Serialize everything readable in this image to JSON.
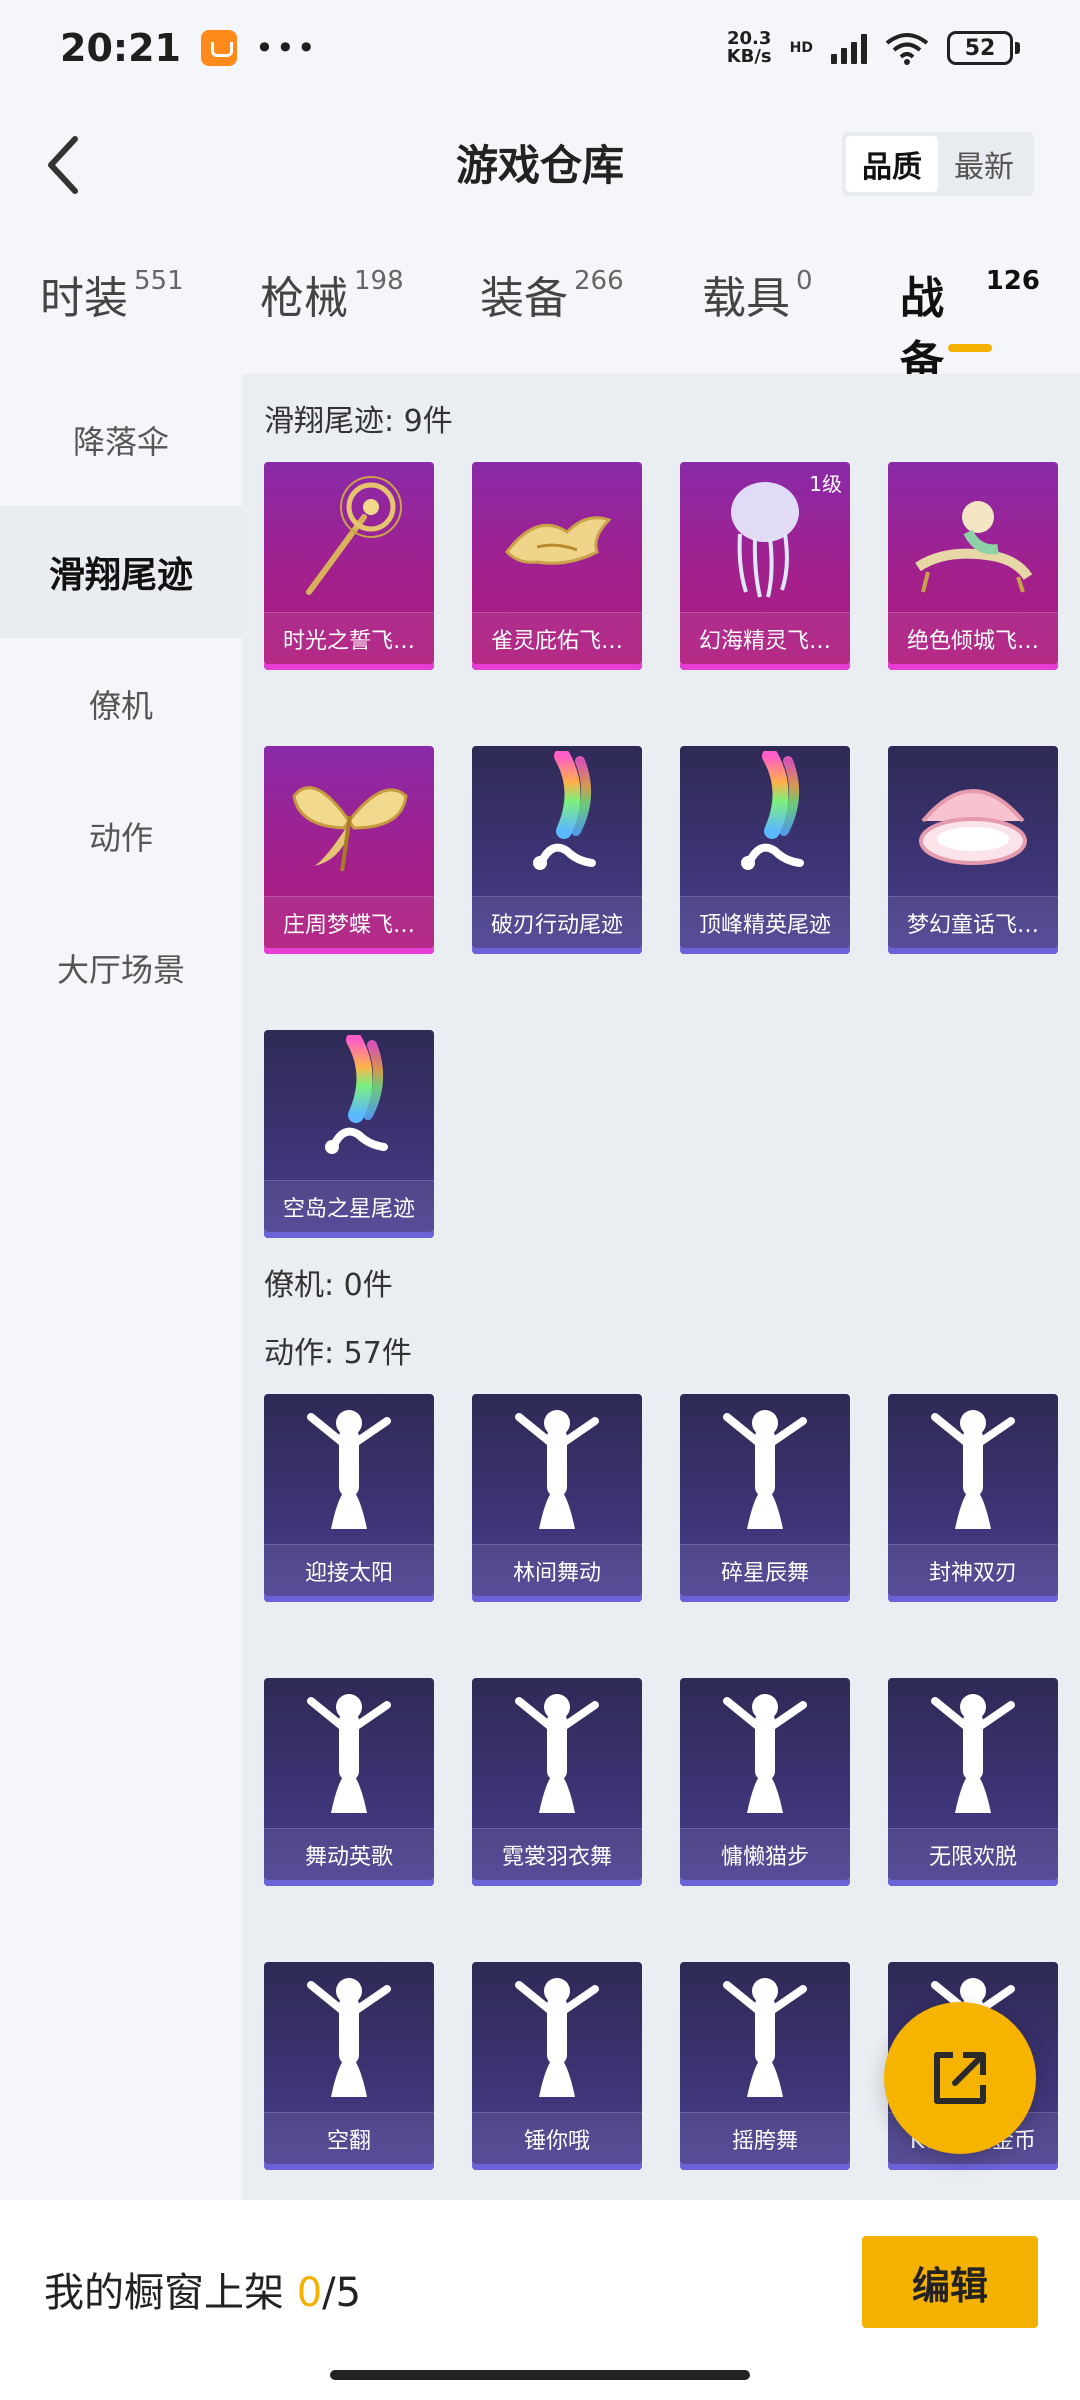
{
  "status": {
    "time": "20:21",
    "net_speed": "20.3",
    "net_unit": "KB/s",
    "hd": "HD",
    "battery": "52"
  },
  "header": {
    "title": "游戏仓库",
    "sort_options": [
      "品质",
      "最新"
    ],
    "sort_active": "品质"
  },
  "tabs": [
    {
      "label": "时装",
      "count": "551"
    },
    {
      "label": "枪械",
      "count": "198"
    },
    {
      "label": "装备",
      "count": "266"
    },
    {
      "label": "载具",
      "count": "0"
    },
    {
      "label": "战备",
      "count": "126",
      "active": true
    }
  ],
  "sidebar": {
    "items": [
      "降落伞",
      "滑翔尾迹",
      "僚机",
      "动作",
      "大厅场景"
    ],
    "active": "滑翔尾迹"
  },
  "sections": {
    "glide": {
      "title": "滑翔尾迹: 9件",
      "items": [
        {
          "label": "时光之誓飞…",
          "style": "purple",
          "icon": "scepter-icon"
        },
        {
          "label": "雀灵庇佑飞…",
          "style": "purple",
          "icon": "golden-bird-icon"
        },
        {
          "label": "幻海精灵飞…",
          "style": "purple",
          "icon": "jellyfish-icon",
          "level": "1级"
        },
        {
          "label": "绝色倾城飞…",
          "style": "purple",
          "icon": "chaise-icon"
        },
        {
          "label": "庄周梦蝶飞…",
          "style": "purple",
          "icon": "butterfly-icon"
        },
        {
          "label": "破刃行动尾迹",
          "style": "dark",
          "icon": "rainbow-trail-icon"
        },
        {
          "label": "顶峰精英尾迹",
          "style": "dark",
          "icon": "rainbow-trail-icon"
        },
        {
          "label": "梦幻童话飞…",
          "style": "dark",
          "icon": "fairy-bed-icon"
        },
        {
          "label": "空岛之星尾迹",
          "style": "dark",
          "icon": "rainbow-trail-icon"
        }
      ]
    },
    "wingman": {
      "title": "僚机: 0件"
    },
    "emotes": {
      "title": "动作: 57件",
      "items": [
        {
          "label": "迎接太阳",
          "icon": "dance-figure-icon"
        },
        {
          "label": "林间舞动",
          "icon": "dance-figure-icon"
        },
        {
          "label": "碎星辰舞",
          "icon": "dance-figure-icon"
        },
        {
          "label": "封神双刃",
          "icon": "dance-figure-icon"
        },
        {
          "label": "舞动英歌",
          "icon": "dance-figure-icon"
        },
        {
          "label": "霓裳羽衣舞",
          "icon": "dance-figure-icon"
        },
        {
          "label": "慵懒猫步",
          "icon": "dance-figure-icon"
        },
        {
          "label": "无限欢脱",
          "icon": "dance-figure-icon"
        },
        {
          "label": "空翻",
          "icon": "dance-figure-icon"
        },
        {
          "label": "锤你哦",
          "icon": "dance-figure-icon"
        },
        {
          "label": "摇胯舞",
          "icon": "dance-figure-icon"
        },
        {
          "label": "KUKU爆金币",
          "icon": "dance-figure-icon"
        },
        {
          "label": "",
          "icon": "dance-figure-icon"
        },
        {
          "label": "",
          "icon": "dance-figure-icon"
        },
        {
          "label": "",
          "icon": "dance-figure-icon"
        },
        {
          "label": "",
          "icon": "dance-figure-icon"
        }
      ]
    }
  },
  "bottom": {
    "showcase_label": "我的橱窗上架",
    "showcase_current": "0",
    "showcase_total": "/5",
    "edit_label": "编辑"
  },
  "colors": {
    "accent": "#f5b100",
    "purple_card": "#a3208c",
    "dark_card": "#3e3577"
  }
}
